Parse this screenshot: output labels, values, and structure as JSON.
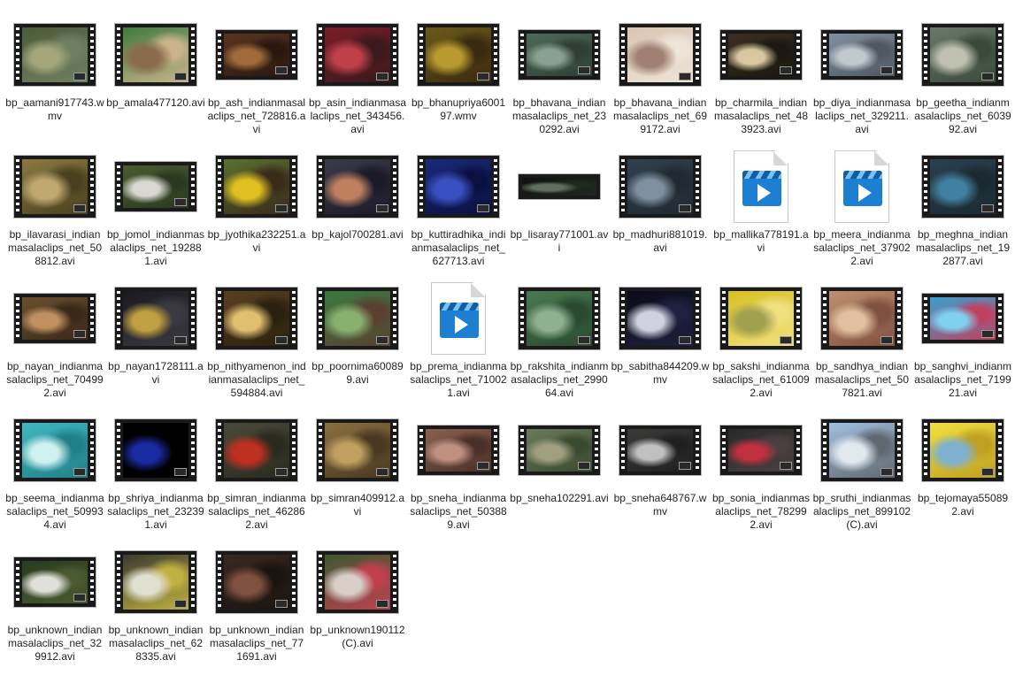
{
  "files": [
    {
      "name": "bp_aamani917743.wmv",
      "thumb": "full",
      "frame": [
        "#4b5a3a",
        "#a3a67a",
        "#6f8060"
      ]
    },
    {
      "name": "bp_amala477120.avi",
      "thumb": "full",
      "frame": [
        "#3f7a3d",
        "#8a6b4d",
        "#c9b48c"
      ]
    },
    {
      "name": "bp_ash_indianmasalaclips_net_728816.avi",
      "thumb": "wide",
      "frame": [
        "#5a3420",
        "#a06a3a",
        "#2a1810"
      ]
    },
    {
      "name": "bp_asin_indianmasalaclips_net_343456.avi",
      "thumb": "full",
      "frame": [
        "#7a1c28",
        "#c0404a",
        "#3a1a1c"
      ]
    },
    {
      "name": "bp_bhanupriya600197.wmv",
      "thumb": "full",
      "frame": [
        "#6a5a1a",
        "#b89a30",
        "#3a2a10"
      ]
    },
    {
      "name": "bp_bhavana_indianmasalaclips_net_230292.avi",
      "thumb": "wide",
      "frame": [
        "#4d6a5a",
        "#8aa090",
        "#2f3f36"
      ]
    },
    {
      "name": "bp_bhavana_indianmasalaclips_net_699172.avi",
      "thumb": "full",
      "frame": [
        "#d9c4b0",
        "#a08070",
        "#efe4d8"
      ]
    },
    {
      "name": "bp_charmila_indianmasalaclips_net_483923.avi",
      "thumb": "wide",
      "frame": [
        "#3a3020",
        "#d8c8a0",
        "#1a1810"
      ]
    },
    {
      "name": "bp_diya_indianmasalaclips_net_329211.avi",
      "thumb": "wide",
      "frame": [
        "#8090a0",
        "#c0c8d0",
        "#505860"
      ]
    },
    {
      "name": "bp_geetha_indianmasalaclips_net_603992.avi",
      "thumb": "full",
      "frame": [
        "#6a7a6a",
        "#c0c0b0",
        "#3a4a3a"
      ]
    },
    {
      "name": "bp_ilavarasi_indianmasalaclips_net_508812.avi",
      "thumb": "full",
      "frame": [
        "#8a7a40",
        "#c0a870",
        "#4a4020"
      ]
    },
    {
      "name": "bp_jomol_indianmasalaclips_net_192881.avi",
      "thumb": "wide",
      "frame": [
        "#4a5a30",
        "#d8d8d0",
        "#2a3a20"
      ]
    },
    {
      "name": "bp_jyothika232251.avi",
      "thumb": "full",
      "frame": [
        "#5a7030",
        "#e0c020",
        "#3a2a1a"
      ]
    },
    {
      "name": "bp_kajol700281.avi",
      "thumb": "full",
      "frame": [
        "#3a3a48",
        "#c08060",
        "#1a1a28"
      ]
    },
    {
      "name": "bp_kuttiradhika_indianmasalaclips_net_627713.avi",
      "thumb": "full",
      "frame": [
        "#1a2a7a",
        "#3a50c0",
        "#0a1040"
      ]
    },
    {
      "name": "bp_lisaray771001.avi",
      "thumb": "thin",
      "frame": [
        "#101010",
        "#607060",
        "#202820"
      ]
    },
    {
      "name": "bp_madhuri881019.avi",
      "thumb": "full",
      "frame": [
        "#304050",
        "#8090a0",
        "#202a30"
      ]
    },
    {
      "name": "bp_mallika778191.avi",
      "thumb": "doc",
      "frame": []
    },
    {
      "name": "bp_meera_indianmasalaclips_net_379022.avi",
      "thumb": "doc",
      "frame": []
    },
    {
      "name": "bp_meghna_indianmasalaclips_net_192877.avi",
      "thumb": "full",
      "frame": [
        "#2a4050",
        "#4080a0",
        "#1a2a30"
      ]
    },
    {
      "name": "bp_nayan_indianmasalaclips_net_704992.avi",
      "thumb": "wide",
      "frame": [
        "#6a5030",
        "#c09060",
        "#3a2818"
      ]
    },
    {
      "name": "bp_nayan1728111.avi",
      "thumb": "full",
      "frame": [
        "#1a1a20",
        "#c0a040",
        "#3a3a40"
      ]
    },
    {
      "name": "bp_nithyamenon_indianmasalaclips_net_594884.avi",
      "thumb": "full",
      "frame": [
        "#5a4020",
        "#e0c070",
        "#2a2010"
      ]
    },
    {
      "name": "bp_poornima600899.avi",
      "thumb": "full",
      "frame": [
        "#3a7a40",
        "#8ab070",
        "#5a4030"
      ]
    },
    {
      "name": "bp_prema_indianmasalaclips_net_710021.avi",
      "thumb": "doc",
      "frame": []
    },
    {
      "name": "bp_rakshita_indianmasalaclips_net_299064.avi",
      "thumb": "full",
      "frame": [
        "#4a7a50",
        "#90b090",
        "#2a4a30"
      ]
    },
    {
      "name": "bp_sabitha844209.wmv",
      "thumb": "full",
      "frame": [
        "#0a0a18",
        "#d0d0e0",
        "#202040"
      ]
    },
    {
      "name": "bp_sakshi_indianmasalaclips_net_610092.avi",
      "thumb": "full",
      "frame": [
        "#d8c020",
        "#a0a050",
        "#f0e080"
      ]
    },
    {
      "name": "bp_sandhya_indianmasalaclips_net_507821.avi",
      "thumb": "full",
      "frame": [
        "#c09070",
        "#e0c0a0",
        "#805040"
      ]
    },
    {
      "name": "bp_sanghvi_indianmasalaclips_net_719921.avi",
      "thumb": "wide",
      "frame": [
        "#3aa0d0",
        "#80d0f0",
        "#c04060"
      ]
    },
    {
      "name": "bp_seema_indianmasalaclips_net_509934.avi",
      "thumb": "full",
      "frame": [
        "#40b8c0",
        "#d0f0f0",
        "#208088"
      ]
    },
    {
      "name": "bp_shriya_indianmasalaclips_net_232391.avi",
      "thumb": "full",
      "frame": [
        "#000000",
        "#1a2aa0",
        "#000000"
      ]
    },
    {
      "name": "bp_simran_indianmasalaclips_net_462862.avi",
      "thumb": "full",
      "frame": [
        "#4a4a3a",
        "#c03020",
        "#2a2a20"
      ]
    },
    {
      "name": "bp_simran409912.avi",
      "thumb": "full",
      "frame": [
        "#8a7040",
        "#c0a060",
        "#4a3820"
      ]
    },
    {
      "name": "bp_sneha_indianmasalaclips_net_503889.avi",
      "thumb": "wide",
      "frame": [
        "#8a6050",
        "#c09080",
        "#4a3028"
      ]
    },
    {
      "name": "bp_sneha102291.avi",
      "thumb": "wide",
      "frame": [
        "#6a7a5a",
        "#a0a080",
        "#3a4a30"
      ]
    },
    {
      "name": "bp_sneha648767.wmv",
      "thumb": "wide",
      "frame": [
        "#3a3a38",
        "#c0c0c0",
        "#202020"
      ]
    },
    {
      "name": "bp_sonia_indianmasalaclips_net_782992.avi",
      "thumb": "wide",
      "frame": [
        "#2a2a2a",
        "#c03040",
        "#4a4040"
      ]
    },
    {
      "name": "bp_sruthi_indianmasalaclips_net_899102(C).avi",
      "thumb": "full",
      "frame": [
        "#a0c0e0",
        "#e0e8f0",
        "#606870"
      ]
    },
    {
      "name": "bp_tejomaya550892.avi",
      "thumb": "full",
      "frame": [
        "#f0e040",
        "#80b0d0",
        "#c0a020"
      ]
    },
    {
      "name": "bp_unknown_indianmasalaclips_net_329912.avi",
      "thumb": "wide",
      "frame": [
        "#2a3a20",
        "#e0e0d8",
        "#4a5a30"
      ]
    },
    {
      "name": "bp_unknown_indianmasalaclips_net_628335.avi",
      "thumb": "full",
      "frame": [
        "#3a3a30",
        "#e0e0d0",
        "#c0b040"
      ]
    },
    {
      "name": "bp_unknown_indianmasalaclips_net_771691.avi",
      "thumb": "full",
      "frame": [
        "#3a2820",
        "#805040",
        "#1a1410"
      ]
    },
    {
      "name": "bp_unknown190112(C).avi",
      "thumb": "full",
      "frame": [
        "#3a5a30",
        "#d8d0c8",
        "#c04050"
      ]
    }
  ]
}
